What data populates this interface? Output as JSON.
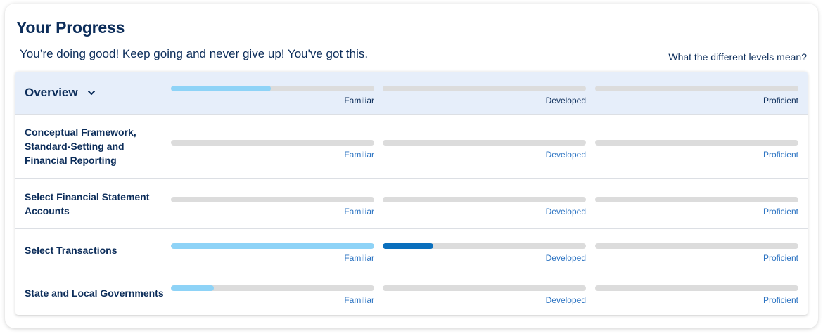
{
  "header": {
    "title": "Your Progress",
    "subtitle": "You’re doing good! Keep going and never give up! You've got this.",
    "levels_link": "What the different levels mean?"
  },
  "levels": [
    "Familiar",
    "Developed",
    "Proficient"
  ],
  "colors": {
    "light_fill": "#8ed3f7",
    "dark_fill": "#0a6fbd",
    "track": "#dcdcdc",
    "overview_bg": "#e6eefa",
    "link": "#2b73c2",
    "navy": "#0c2d5a"
  },
  "overview": {
    "label": "Overview",
    "icon": "chevron-down-icon",
    "progress": [
      0.49,
      0,
      0
    ]
  },
  "rows": [
    {
      "label": "Conceptual Framework, Standard-Setting and Financial Reporting",
      "progress": [
        0,
        0,
        0
      ]
    },
    {
      "label": "Select Financial Statement Accounts",
      "progress": [
        0,
        0,
        0
      ]
    },
    {
      "label": "Select Transactions",
      "progress": [
        1.0,
        0.25,
        0
      ]
    },
    {
      "label": "State and Local Governments",
      "progress": [
        0.21,
        0,
        0
      ]
    }
  ]
}
